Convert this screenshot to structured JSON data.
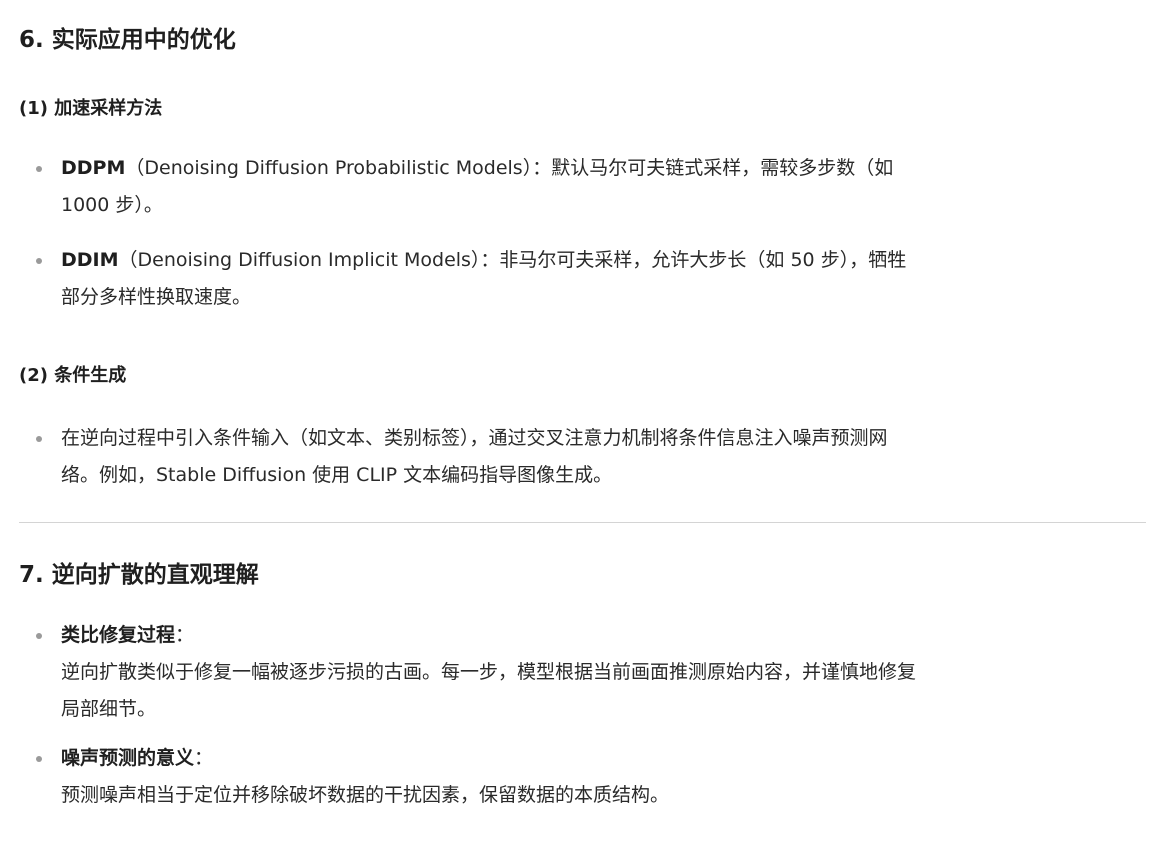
{
  "section6": {
    "heading": "6. 实际应用中的优化",
    "sub1": {
      "heading": "(1) 加速采样方法",
      "items": [
        {
          "term": "DDPM",
          "line1": "（Denoising Diffusion Probabilistic Models）：默认马尔可夫链式采样，需较多步数（如",
          "line2": "1000 步）。"
        },
        {
          "term": "DDIM",
          "line1": "（Denoising Diffusion Implicit Models）：非马尔可夫采样，允许大步长（如 50 步），牺牲",
          "line2": "部分多样性换取速度。"
        }
      ]
    },
    "sub2": {
      "heading": "(2) 条件生成",
      "items": [
        {
          "line1": "在逆向过程中引入条件输入（如文本、类别标签），通过交叉注意力机制将条件信息注入噪声预测网",
          "line2": "络。例如，Stable Diffusion 使用 CLIP 文本编码指导图像生成。"
        }
      ]
    }
  },
  "section7": {
    "heading": "7. 逆向扩散的直观理解",
    "items": [
      {
        "term": "类比修复过程",
        "colon": "：",
        "line1": "逆向扩散类似于修复一幅被逐步污损的古画。每一步，模型根据当前画面推测原始内容，并谨慎地修复",
        "line2": "局部细节。"
      },
      {
        "term": "噪声预测的意义",
        "colon": "：",
        "line1": "预测噪声相当于定位并移除破坏数据的干扰因素，保留数据的本质结构。"
      }
    ]
  }
}
